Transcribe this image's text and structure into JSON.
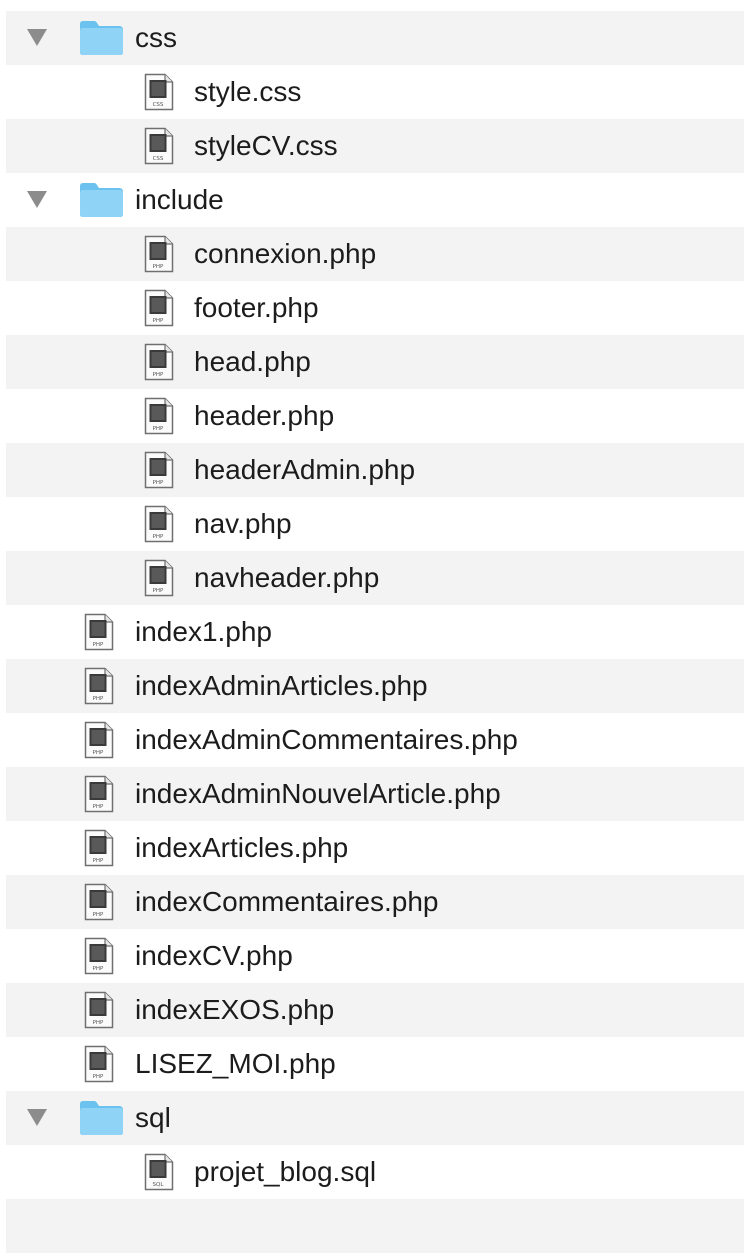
{
  "rows": [
    {
      "type": "folder",
      "depth": 0,
      "label": "css",
      "expanded": true,
      "stripe": true
    },
    {
      "type": "file",
      "depth": 1,
      "label": "style.css",
      "ext": "CSS",
      "stripe": false
    },
    {
      "type": "file",
      "depth": 1,
      "label": "styleCV.css",
      "ext": "CSS",
      "stripe": true
    },
    {
      "type": "folder",
      "depth": 0,
      "label": "include",
      "expanded": true,
      "stripe": false
    },
    {
      "type": "file",
      "depth": 1,
      "label": "connexion.php",
      "ext": "PHP",
      "stripe": true
    },
    {
      "type": "file",
      "depth": 1,
      "label": "footer.php",
      "ext": "PHP",
      "stripe": false
    },
    {
      "type": "file",
      "depth": 1,
      "label": "head.php",
      "ext": "PHP",
      "stripe": true
    },
    {
      "type": "file",
      "depth": 1,
      "label": "header.php",
      "ext": "PHP",
      "stripe": false
    },
    {
      "type": "file",
      "depth": 1,
      "label": "headerAdmin.php",
      "ext": "PHP",
      "stripe": true
    },
    {
      "type": "file",
      "depth": 1,
      "label": "nav.php",
      "ext": "PHP",
      "stripe": false
    },
    {
      "type": "file",
      "depth": 1,
      "label": "navheader.php",
      "ext": "PHP",
      "stripe": true
    },
    {
      "type": "file",
      "depth": 0,
      "label": "index1.php",
      "ext": "PHP",
      "stripe": false
    },
    {
      "type": "file",
      "depth": 0,
      "label": "indexAdminArticles.php",
      "ext": "PHP",
      "stripe": true
    },
    {
      "type": "file",
      "depth": 0,
      "label": "indexAdminCommentaires.php",
      "ext": "PHP",
      "stripe": false
    },
    {
      "type": "file",
      "depth": 0,
      "label": "indexAdminNouvelArticle.php",
      "ext": "PHP",
      "stripe": true
    },
    {
      "type": "file",
      "depth": 0,
      "label": "indexArticles.php",
      "ext": "PHP",
      "stripe": false
    },
    {
      "type": "file",
      "depth": 0,
      "label": "indexCommentaires.php",
      "ext": "PHP",
      "stripe": true
    },
    {
      "type": "file",
      "depth": 0,
      "label": "indexCV.php",
      "ext": "PHP",
      "stripe": false
    },
    {
      "type": "file",
      "depth": 0,
      "label": "indexEXOS.php",
      "ext": "PHP",
      "stripe": true
    },
    {
      "type": "file",
      "depth": 0,
      "label": "LISEZ_MOI.php",
      "ext": "PHP",
      "stripe": false
    },
    {
      "type": "folder",
      "depth": 0,
      "label": "sql",
      "expanded": true,
      "stripe": true
    },
    {
      "type": "file",
      "depth": 1,
      "label": "projet_blog.sql",
      "ext": "SQL",
      "stripe": false
    },
    {
      "type": "empty",
      "stripe": true
    }
  ],
  "colors": {
    "folder_fill": "#8fd3f7",
    "folder_tab": "#6cc2ee",
    "stripe": "#f3f3f3",
    "disclosure": "#8c8c8c"
  },
  "icons": {
    "folder": "folder-icon",
    "file": "document-icon",
    "disclosure": "disclosure-triangle-icon"
  }
}
